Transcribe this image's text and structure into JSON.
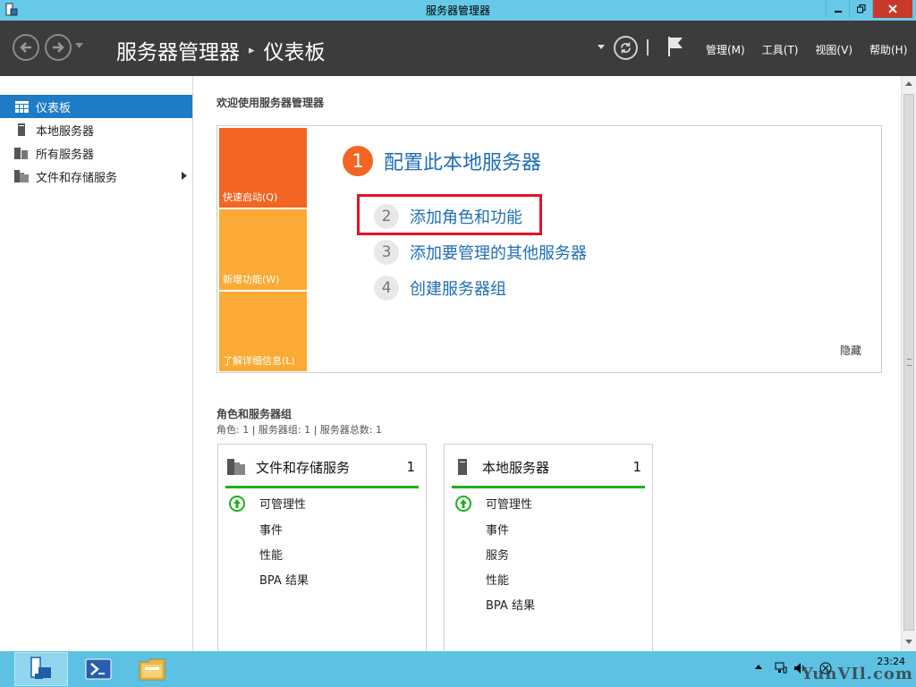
{
  "window": {
    "title": "服务器管理器"
  },
  "header": {
    "breadcrumb_root": "服务器管理器",
    "breadcrumb_page": "仪表板",
    "menu": [
      "管理(M)",
      "工具(T)",
      "视图(V)",
      "帮助(H)"
    ]
  },
  "sidebar": {
    "items": [
      {
        "label": "仪表板",
        "icon": "dashboard-icon",
        "active": true
      },
      {
        "label": "本地服务器",
        "icon": "server-icon"
      },
      {
        "label": "所有服务器",
        "icon": "servers-icon"
      },
      {
        "label": "文件和存储服务",
        "icon": "file-storage-icon",
        "has_children": true
      }
    ]
  },
  "welcome": {
    "heading": "欢迎使用服务器管理器",
    "tiles": [
      "快速启动(Q)",
      "新增功能(W)",
      "了解详细信息(L)"
    ],
    "steps": [
      {
        "num": "1",
        "label": "配置此本地服务器"
      },
      {
        "num": "2",
        "label": "添加角色和功能"
      },
      {
        "num": "3",
        "label": "添加要管理的其他服务器"
      },
      {
        "num": "4",
        "label": "创建服务器组"
      }
    ],
    "hide": "隐藏"
  },
  "roles": {
    "title": "角色和服务器组",
    "summary": "角色: 1 | 服务器组: 1 | 服务器总数: 1",
    "cards": [
      {
        "title": "文件和存储服务",
        "count": "1",
        "rows": [
          "可管理性",
          "事件",
          "性能",
          "BPA 结果"
        ]
      },
      {
        "title": "本地服务器",
        "count": "1",
        "rows": [
          "可管理性",
          "事件",
          "服务",
          "性能",
          "BPA 结果"
        ]
      }
    ]
  },
  "taskbar": {
    "time": "23:24",
    "watermark": "YunVIl.com"
  },
  "colors": {
    "accent_orange": "#f26522",
    "tile_yellow": "#fbaa35",
    "link_blue": "#1e6eb5",
    "status_green": "#1fae1f",
    "highlight_red": "#e81123",
    "titlebar": "#66c9e8",
    "header": "#3c3c3c"
  }
}
